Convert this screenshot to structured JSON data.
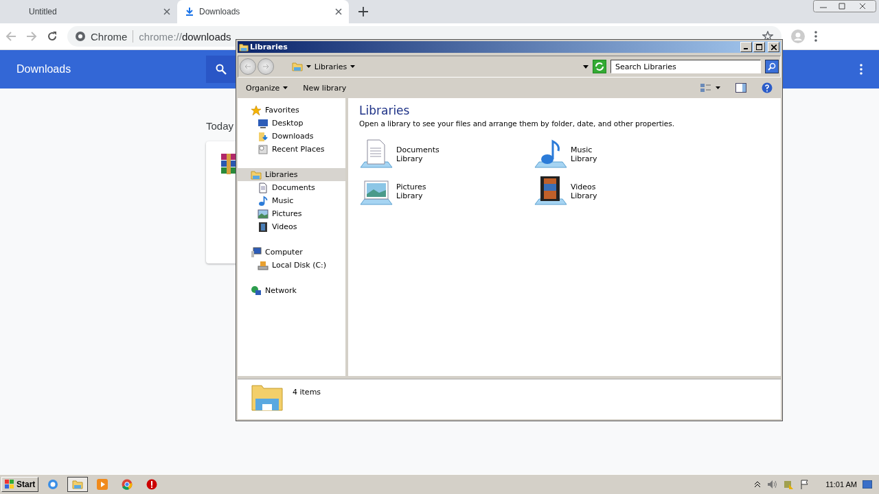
{
  "browser": {
    "tabs": [
      {
        "title": "Untitled",
        "selected": false
      },
      {
        "title": "Downloads",
        "selected": true
      }
    ],
    "address": {
      "site": "Chrome",
      "scheme": "chrome://",
      "path": "downloads"
    },
    "header": {
      "title": "Downloads"
    },
    "section": "Today"
  },
  "explorer": {
    "title": "Libraries",
    "breadcrumb": "Libraries",
    "search": {
      "placeholder": "Search Libraries"
    },
    "toolbar": [
      {
        "label": "Organize",
        "dropdown": true
      },
      {
        "label": "New library",
        "dropdown": false
      }
    ],
    "nav": [
      {
        "label": "Favorites",
        "selected": false,
        "children": [
          {
            "label": "Desktop",
            "selected": false
          },
          {
            "label": "Downloads",
            "selected": false
          },
          {
            "label": "Recent Places",
            "selected": false
          }
        ]
      },
      {
        "label": "Libraries",
        "selected": true,
        "children": [
          {
            "label": "Documents",
            "selected": false
          },
          {
            "label": "Music",
            "selected": false
          },
          {
            "label": "Pictures",
            "selected": false
          },
          {
            "label": "Videos",
            "selected": false
          }
        ]
      },
      {
        "label": "Computer",
        "selected": false,
        "children": [
          {
            "label": "Local Disk (C:)",
            "selected": false
          }
        ]
      },
      {
        "label": "Network",
        "selected": false
      }
    ],
    "heading": "Libraries",
    "description": "Open a library to see your files and arrange them by folder, date, and other properties.",
    "libraries": [
      {
        "name": "Documents",
        "type": "Library"
      },
      {
        "name": "Music",
        "type": "Library"
      },
      {
        "name": "Pictures",
        "type": "Library"
      },
      {
        "name": "Videos",
        "type": "Library"
      }
    ],
    "details": "4 items"
  },
  "taskbar": {
    "start": "Start",
    "clock": "11:01 AM"
  }
}
